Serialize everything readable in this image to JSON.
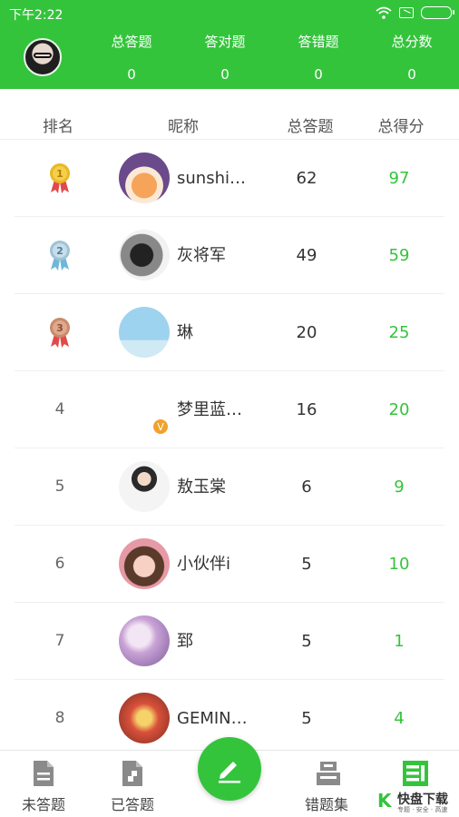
{
  "status_bar": {
    "time": "下午2:22"
  },
  "summary": {
    "items": [
      {
        "label": "总答题",
        "value": "0"
      },
      {
        "label": "答对题",
        "value": "0"
      },
      {
        "label": "答错题",
        "value": "0"
      },
      {
        "label": "总分数",
        "value": "0"
      }
    ]
  },
  "table": {
    "headers": [
      "排名",
      "昵称",
      "总答题",
      "总得分"
    ],
    "rows": [
      {
        "rank": "1",
        "nickname": "sunshi…",
        "total": "62",
        "score": "97"
      },
      {
        "rank": "2",
        "nickname": "灰将军",
        "total": "49",
        "score": "59"
      },
      {
        "rank": "3",
        "nickname": "琳",
        "total": "20",
        "score": "25"
      },
      {
        "rank": "4",
        "nickname": "梦里蓝…",
        "total": "16",
        "score": "20"
      },
      {
        "rank": "5",
        "nickname": "敖玉棠",
        "total": "6",
        "score": "9"
      },
      {
        "rank": "6",
        "nickname": "小伙伴i",
        "total": "5",
        "score": "10"
      },
      {
        "rank": "7",
        "nickname": "郅",
        "total": "5",
        "score": "1"
      },
      {
        "rank": "8",
        "nickname": "GEMIN…",
        "total": "5",
        "score": "4"
      }
    ]
  },
  "medals": {
    "gold": "#e8b824",
    "silver": "#9fc3d6",
    "bronze": "#c98a6a",
    "ribbon": "#e24a4a"
  },
  "bottom_nav": {
    "items": [
      {
        "label": "未答题",
        "icon": "document-icon"
      },
      {
        "label": "已答题",
        "icon": "document-check-icon"
      },
      {
        "label": "错题集",
        "icon": "stack-icon"
      },
      {
        "label": "",
        "icon": "list-icon"
      }
    ],
    "fab_icon": "pencil-icon"
  },
  "watermark": {
    "text": "快盘下载",
    "sub": "专题 · 安全 · 高速"
  },
  "colors": {
    "brand_green": "#34c43c"
  }
}
